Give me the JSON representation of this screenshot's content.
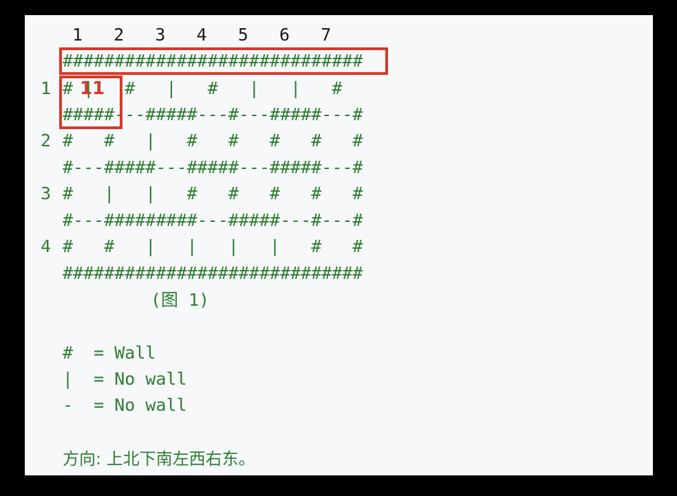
{
  "maze": {
    "column_numbers": "1   2   3   4   5   6   7",
    "lines": [
      "#############################",
      "# |   #   |   #   |   |   #",
      "#####---#####---#---#####---#",
      "#   #   |   #   #   #   #   #",
      "#---#####---#####---#####---#",
      "#   |   |   #   #   #   #   #",
      "#---#########---#####---#---#",
      "#   #   |   |   |   |   #   #",
      "#############################"
    ],
    "row_labels": [
      "1",
      "2",
      "3",
      "4"
    ],
    "caption": "(图 1)"
  },
  "legend": [
    "#  = Wall",
    "|  = No wall",
    "-  = No wall"
  ],
  "direction_text": "方向: 上北下南左西右东。",
  "annotation": {
    "marker_label": "11",
    "color": "#d53a2b"
  },
  "colors": {
    "code_green": "#2f7d32",
    "panel_bg": "#f6f8fa",
    "outer_bg": "#000000",
    "highlight_red": "#d53a2b"
  }
}
